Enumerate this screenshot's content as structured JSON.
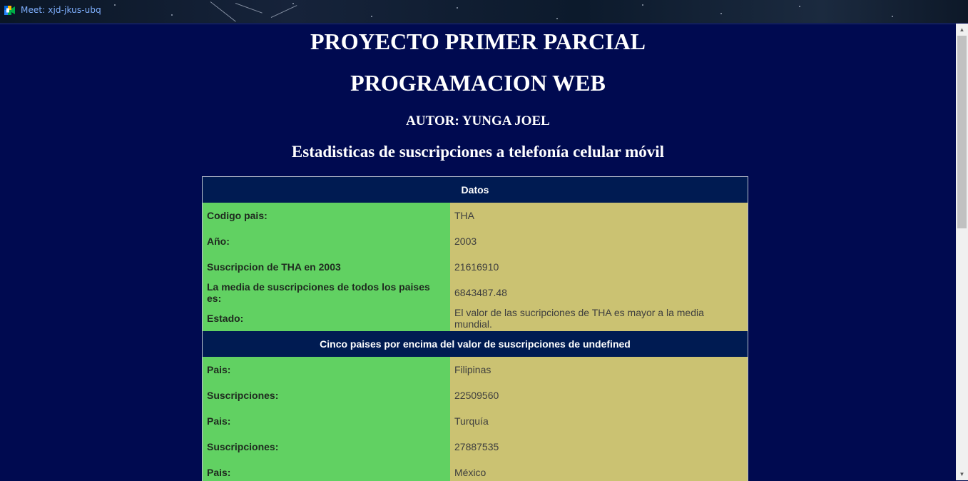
{
  "browser": {
    "tab_title": "Meet: xjd-jkus-ubq",
    "icon": "google-meet-icon"
  },
  "page": {
    "title_line1": "PROYECTO PRIMER PARCIAL",
    "title_line2": "PROGRAMACION WEB",
    "author": "AUTOR: YUNGA JOEL",
    "subtitle": "Estadisticas de suscripciones a telefonía celular móvil"
  },
  "table": {
    "header_datos": "Datos",
    "datos_rows": [
      {
        "label": "Codigo pais:",
        "value": "THA"
      },
      {
        "label": "Año:",
        "value": "2003"
      },
      {
        "label": "Suscripcion de THA en 2003",
        "value": "21616910"
      },
      {
        "label": "La media de suscripciones de todos los paises es:",
        "value": "6843487.48"
      },
      {
        "label": "Estado:",
        "value": "El valor de las sucripciones de THA es mayor a la media mundial."
      }
    ],
    "header_cinco": "Cinco paises por encima del valor de suscripciones de undefined",
    "cinco_rows": [
      {
        "label": "Pais:",
        "value": "Filipinas"
      },
      {
        "label": "Suscripciones:",
        "value": "22509560"
      },
      {
        "label": "Pais:",
        "value": "Turquía"
      },
      {
        "label": "Suscripciones:",
        "value": "27887535"
      },
      {
        "label": "Pais:",
        "value": "México"
      }
    ]
  },
  "colors": {
    "page_background": "#000a50",
    "header_cell": "#001b52",
    "label_cell": "#61d162",
    "value_cell": "#cbc272"
  }
}
